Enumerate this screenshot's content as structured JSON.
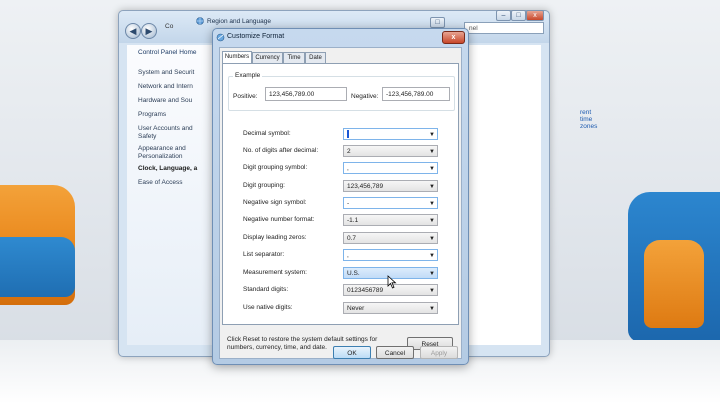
{
  "background_window": {
    "address_label": "Co",
    "search_placeholder": "nel",
    "nav_items": [
      "Control Panel Home",
      "System and Securit",
      "Network and Intern",
      "Hardware and Sou",
      "Programs",
      "User Accounts and",
      "Safety",
      "Appearance and",
      "Personalization",
      "Clock, Language, a",
      "Ease of Access"
    ],
    "time_zones_link": "rent time zones"
  },
  "region_window": {
    "title": "Region and Language"
  },
  "dialog": {
    "title": "Customize Format",
    "close_label": "x",
    "tabs": [
      "Numbers",
      "Currency",
      "Time",
      "Date"
    ],
    "example": {
      "legend": "Example",
      "positive_label": "Positive:",
      "positive_value": "123,456,789.00",
      "negative_label": "Negative:",
      "negative_value": "-123,456,789.00"
    },
    "settings": [
      {
        "label": "Decimal symbol:",
        "value": ""
      },
      {
        "label": "No. of digits after decimal:",
        "value": "2"
      },
      {
        "label": "Digit grouping symbol:",
        "value": ","
      },
      {
        "label": "Digit grouping:",
        "value": "123,456,789"
      },
      {
        "label": "Negative sign symbol:",
        "value": "-"
      },
      {
        "label": "Negative number format:",
        "value": "-1.1"
      },
      {
        "label": "Display leading zeros:",
        "value": "0.7"
      },
      {
        "label": "List separator:",
        "value": ","
      },
      {
        "label": "Measurement system:",
        "value": "U.S."
      },
      {
        "label": "Standard digits:",
        "value": "0123456789"
      },
      {
        "label": "Use native digits:",
        "value": "Never"
      }
    ],
    "note": "Click Reset to restore the system default settings for numbers, currency, time, and date.",
    "reset_label": "Reset",
    "ok_label": "OK",
    "cancel_label": "Cancel",
    "apply_label": "Apply"
  },
  "colors": {
    "dialog_frame": "#b4cbe4",
    "selection": "#c1dbf7",
    "sofa_orange": "#e9861a",
    "sofa_blue": "#1f6eb2"
  }
}
